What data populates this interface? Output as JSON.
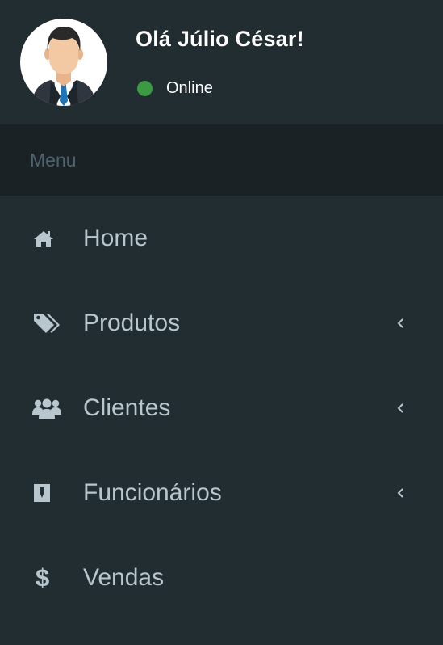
{
  "user": {
    "greeting": "Olá Júlio César!",
    "status": "Online",
    "status_color": "#3c9a43",
    "avatar_icon": "businessman-avatar"
  },
  "menu": {
    "header": "Menu",
    "items": [
      {
        "label": "Home",
        "icon": "home-icon",
        "has_submenu": false
      },
      {
        "label": "Produtos",
        "icon": "tags-icon",
        "has_submenu": true
      },
      {
        "label": "Clientes",
        "icon": "users-icon",
        "has_submenu": true
      },
      {
        "label": "Funcionários",
        "icon": "id-badge-icon",
        "has_submenu": true
      },
      {
        "label": "Vendas",
        "icon": "dollar-icon",
        "has_submenu": false
      }
    ]
  },
  "colors": {
    "sidebar_bg": "#222d32",
    "header_bg": "#1a2226",
    "header_text": "#4b646f",
    "item_text": "#b8c7ce"
  }
}
